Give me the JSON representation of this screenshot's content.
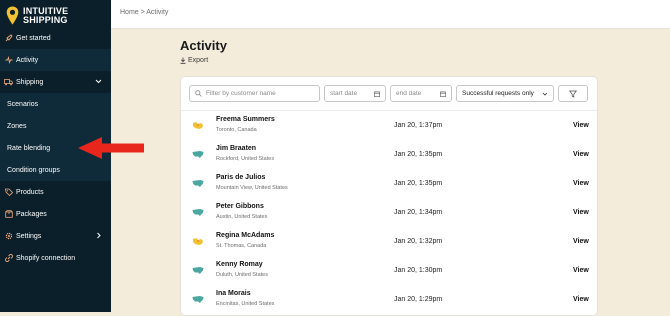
{
  "brand": {
    "line1": "INTUITIVE",
    "line2": "SHIPPING"
  },
  "sidebar": {
    "items": [
      {
        "label": "Get started"
      },
      {
        "label": "Activity"
      },
      {
        "label": "Shipping"
      },
      {
        "label": "Scenarios"
      },
      {
        "label": "Zones"
      },
      {
        "label": "Rate blending"
      },
      {
        "label": "Condition groups"
      },
      {
        "label": "Products"
      },
      {
        "label": "Packages"
      },
      {
        "label": "Settings"
      },
      {
        "label": "Shopify connection"
      }
    ]
  },
  "breadcrumb": "Home > Activity",
  "page": {
    "title": "Activity",
    "export_label": "Export"
  },
  "filters": {
    "search_placeholder": "Filter by customer name",
    "start_placeholder": "start date",
    "end_placeholder": "end date",
    "status_selected": "Successful requests only"
  },
  "rows": [
    {
      "name": "Freema Summers",
      "location": "Toronto, Canada",
      "date": "Jan 20, 1:37pm",
      "action": "View",
      "country_icon": "canada-flag-icon"
    },
    {
      "name": "Jim Braaten",
      "location": "Rockford, United States",
      "date": "Jan 20, 1:35pm",
      "action": "View",
      "country_icon": "usa-map-icon"
    },
    {
      "name": "Paris de Julios",
      "location": "Mountain View, United States",
      "date": "Jan 20, 1:35pm",
      "action": "View",
      "country_icon": "usa-map-icon"
    },
    {
      "name": "Peter Gibbons",
      "location": "Austin, United States",
      "date": "Jan 20, 1:34pm",
      "action": "View",
      "country_icon": "usa-map-icon"
    },
    {
      "name": "Regina McAdams",
      "location": "St. Thomas, Canada",
      "date": "Jan 20, 1:32pm",
      "action": "View",
      "country_icon": "canada-flag-icon"
    },
    {
      "name": "Kenny Romay",
      "location": "Duluth, United States",
      "date": "Jan 20, 1:30pm",
      "action": "View",
      "country_icon": "usa-map-icon"
    },
    {
      "name": "Ina Morais",
      "location": "Encinitas, United States",
      "date": "Jan 20, 1:29pm",
      "action": "View",
      "country_icon": "usa-map-icon"
    }
  ],
  "colors": {
    "sidebar_bg": "#0b1f2a",
    "page_bg": "#f4ecdb",
    "accent": "#f0a87a",
    "usa_icon": "#4aa8a0",
    "canada_icon": "#f2c230",
    "arrow": "#e8261c"
  }
}
